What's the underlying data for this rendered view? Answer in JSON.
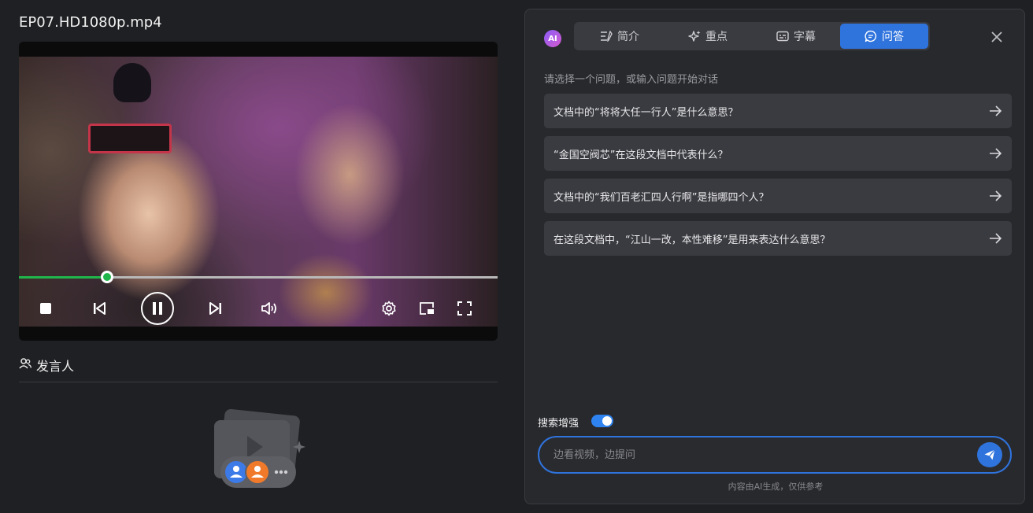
{
  "left": {
    "file_title": "EP07.HD1080p.mp4",
    "player": {
      "progress": 0.185
    },
    "speaker_section": {
      "title": "发言人"
    }
  },
  "panel": {
    "ai_badge": "AI",
    "tabs": [
      {
        "label": "简介",
        "icon": "summary-icon",
        "active": false
      },
      {
        "label": "重点",
        "icon": "sparkle-icon",
        "active": false
      },
      {
        "label": "字幕",
        "icon": "subtitle-icon",
        "active": false
      },
      {
        "label": "问答",
        "icon": "chat-bubble-icon",
        "active": true
      }
    ],
    "prompt": "请选择一个问题，或输入问题开始对话",
    "questions": [
      "文档中的“将将大任一行人”是什么意思？",
      "“金国空阀芯”在这段文档中代表什么？",
      "文档中的“我们百老汇四人行啊”是指哪四个人？",
      "在这段文档中，“江山一改，本性难移”是用来表达什么意思？"
    ],
    "search_enhance_label": "搜索增强",
    "search_enhance_on": true,
    "input_placeholder": "边看视频，边提问",
    "disclaimer": "内容由AI生成，仅供参考"
  },
  "colors": {
    "accent": "#2f73dd",
    "progress": "#20b64b",
    "background": "#1f2023",
    "panel": "#28292d"
  }
}
